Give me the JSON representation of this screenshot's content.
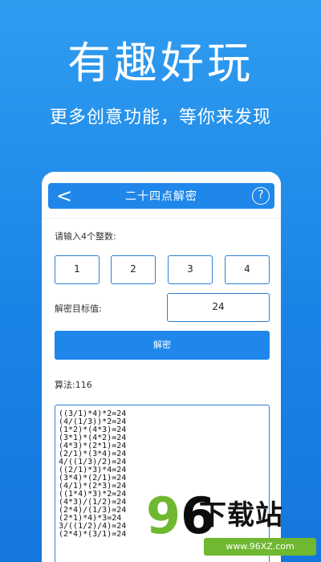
{
  "promo": {
    "headline": "有趣好玩",
    "subline": "更多创意功能，等你来发现"
  },
  "appbar": {
    "back_glyph": "<",
    "title": "二十四点解密",
    "help_glyph": "?"
  },
  "form": {
    "prompt": "请输入4个整数:",
    "numbers": [
      "1",
      "2",
      "3",
      "4"
    ],
    "target_label": "解密目标值:",
    "target_value": "24",
    "solve_label": "解密",
    "algo_label": "算法:116"
  },
  "results": [
    "((3/1)*4)*2=24",
    "(4/(1/3))*2=24",
    "(1*2)*(4*3)=24",
    "(3*1)*(4*2)=24",
    "(4*3)*(2*1)=24",
    "(2/1)*(3*4)=24",
    "4/((1/3)/2)=24",
    "((2/1)*3)*4=24",
    "(3*4)*(2/1)=24",
    "(4/1)*(2*3)=24",
    "((1*4)*3)*2=24",
    "(4*3)/(1/2)=24",
    "(2*4)/(1/3)=24",
    "(2*1)*4)*3=24",
    "3/((1/2)/4)=24",
    "(2*4)*(3/1)=24"
  ],
  "watermark": {
    "num_9": "9",
    "num_6": "6",
    "text": "下载站",
    "url": "www.96XZ.com"
  },
  "colors": {
    "background": "#1a84e6",
    "accent": "#1f87ea",
    "brand_green": "#6fb830"
  }
}
